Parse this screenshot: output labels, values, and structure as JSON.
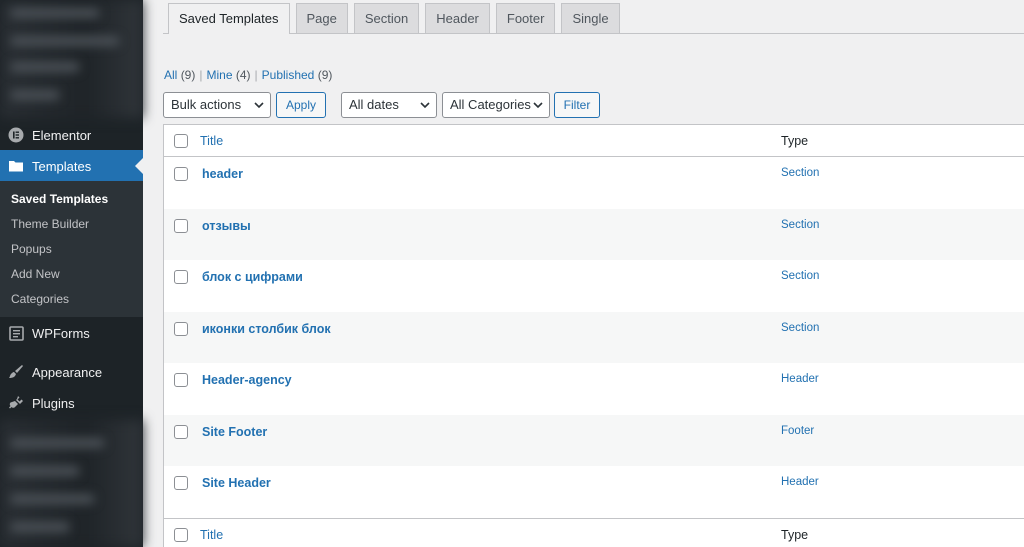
{
  "sidebar": {
    "items": [
      {
        "label": "Elementor",
        "icon": "elementor-icon"
      },
      {
        "label": "Templates",
        "icon": "folder-icon",
        "active": true
      },
      {
        "label": "WPForms",
        "icon": "forms-icon"
      },
      {
        "label": "Appearance",
        "icon": "brush-icon"
      },
      {
        "label": "Plugins",
        "icon": "plugin-icon"
      }
    ],
    "submenu": [
      "Saved Templates",
      "Theme Builder",
      "Popups",
      "Add New",
      "Categories"
    ]
  },
  "tabs": [
    "Saved Templates",
    "Page",
    "Section",
    "Header",
    "Footer",
    "Single"
  ],
  "filters": {
    "all_label": "All",
    "all_count": "(9)",
    "mine_label": "Mine",
    "mine_count": "(4)",
    "published_label": "Published",
    "published_count": "(9)"
  },
  "toolbar": {
    "bulk_actions": "Bulk actions",
    "apply": "Apply",
    "dates": "All dates",
    "categories": "All Categories",
    "filter": "Filter"
  },
  "table": {
    "columns": {
      "title": "Title",
      "type": "Type"
    },
    "rows": [
      {
        "title": "header",
        "type": "Section"
      },
      {
        "title": "отзывы",
        "type": "Section"
      },
      {
        "title": "блок с цифрами",
        "type": "Section"
      },
      {
        "title": "иконки столбик блок",
        "type": "Section"
      },
      {
        "title": "Header-agency",
        "type": "Header"
      },
      {
        "title": "Site Footer",
        "type": "Footer"
      },
      {
        "title": "Site Header",
        "type": "Header"
      }
    ]
  },
  "colors": {
    "accent": "#2271b1",
    "sidebar_bg": "#1d2327",
    "page_bg": "#f0f0f1"
  }
}
